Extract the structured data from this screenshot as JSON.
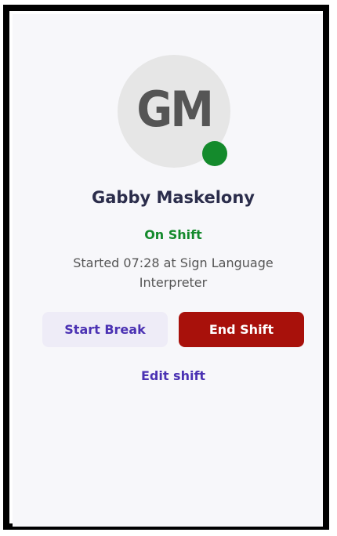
{
  "profile": {
    "initials": "GM",
    "name": "Gabby Maskelony",
    "status_color": "#148a2c",
    "avatar_color": "#e6e6e6"
  },
  "shift": {
    "status": "On Shift",
    "detail": "Started 07:28 at Sign Language Interpreter"
  },
  "actions": {
    "start_break_label": "Start Break",
    "end_shift_label": "End Shift",
    "edit_shift_label": "Edit shift",
    "end_shift_color": "#a8110b",
    "accent_color": "#4b32b3"
  }
}
